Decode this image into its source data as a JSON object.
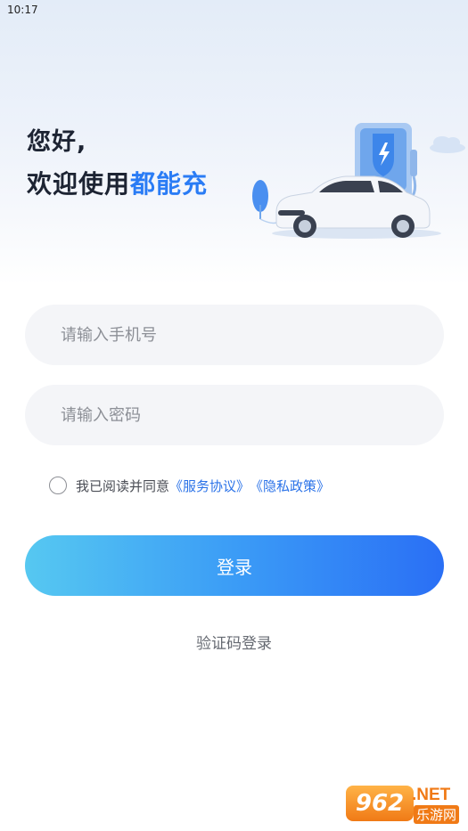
{
  "status_bar": {
    "time": "10:17"
  },
  "header": {
    "greeting": "您好,",
    "welcome_prefix": "欢迎使用",
    "brand_name": "都能充",
    "illustration_icon": "ev-charger-with-car-illustration"
  },
  "form": {
    "phone_placeholder": "请输入手机号",
    "password_placeholder": "请输入密码",
    "agreement": {
      "checked": false,
      "prefix": "我已阅读并同意",
      "service_link": "《服务协议》",
      "privacy_link": "《隐私政策》"
    },
    "login_button": "登录",
    "code_login_link": "验证码登录"
  },
  "watermark": {
    "badge": "962",
    "net": ".NET",
    "sub": "乐游网"
  },
  "colors": {
    "brand": "#2a7cf5",
    "link": "#2a72e8",
    "button_gradient_start": "#56c8f1",
    "button_gradient_end": "#2a6ff5",
    "input_bg": "#f4f5f8",
    "title": "#1d2433"
  }
}
